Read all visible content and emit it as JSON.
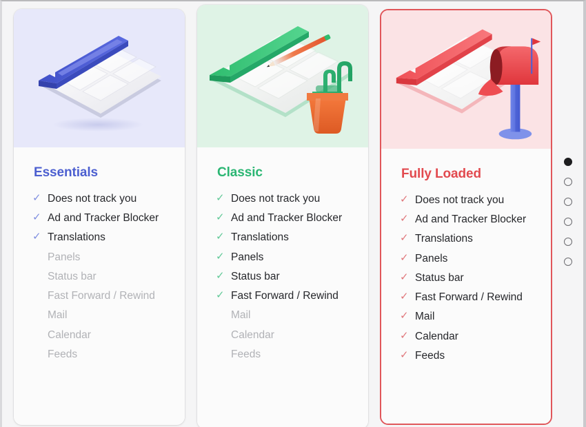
{
  "plans": [
    {
      "id": "essentials",
      "title": "Essentials",
      "accent": "#4c5fd0",
      "check_color": "#7f8ee0",
      "illustration": "keyboard-blue-icon",
      "illustration_bg": "#e7e8fa",
      "selected": false,
      "features": [
        {
          "label": "Does not track you",
          "included": true
        },
        {
          "label": "Ad and Tracker Blocker",
          "included": true
        },
        {
          "label": "Translations",
          "included": true
        },
        {
          "label": "Panels",
          "included": false
        },
        {
          "label": "Status bar",
          "included": false
        },
        {
          "label": "Fast Forward / Rewind",
          "included": false
        },
        {
          "label": "Mail",
          "included": false
        },
        {
          "label": "Calendar",
          "included": false
        },
        {
          "label": "Feeds",
          "included": false
        }
      ]
    },
    {
      "id": "classic",
      "title": "Classic",
      "accent": "#2bb673",
      "check_color": "#62c998",
      "illustration": "keyboard-green-cactus-pencil-icon",
      "illustration_bg": "#dff3e6",
      "selected": false,
      "features": [
        {
          "label": "Does not track you",
          "included": true
        },
        {
          "label": "Ad and Tracker Blocker",
          "included": true
        },
        {
          "label": "Translations",
          "included": true
        },
        {
          "label": "Panels",
          "included": true
        },
        {
          "label": "Status bar",
          "included": true
        },
        {
          "label": "Fast Forward / Rewind",
          "included": true
        },
        {
          "label": "Mail",
          "included": false
        },
        {
          "label": "Calendar",
          "included": false
        },
        {
          "label": "Feeds",
          "included": false
        }
      ]
    },
    {
      "id": "fully-loaded",
      "title": "Fully Loaded",
      "accent": "#e24a4f",
      "check_color": "#e0787c",
      "illustration": "keyboard-red-mailbox-icon",
      "illustration_bg": "#fbe3e5",
      "selected": true,
      "features": [
        {
          "label": "Does not track you",
          "included": true
        },
        {
          "label": "Ad and Tracker Blocker",
          "included": true
        },
        {
          "label": "Translations",
          "included": true
        },
        {
          "label": "Panels",
          "included": true
        },
        {
          "label": "Status bar",
          "included": true
        },
        {
          "label": "Fast Forward / Rewind",
          "included": true
        },
        {
          "label": "Mail",
          "included": true
        },
        {
          "label": "Calendar",
          "included": true
        },
        {
          "label": "Feeds",
          "included": true
        }
      ]
    }
  ],
  "check_glyph": "✓",
  "pager": {
    "total": 6,
    "active_index": 0,
    "active_color": "#1d1d1f",
    "inactive_border_color": "#6b6b70"
  },
  "colors": {
    "page_background": "#f5f5f6",
    "card_background": "#fbfbfb",
    "feature_text": "#26272b",
    "feature_text_disabled": "#b1b2b6",
    "selected_border": "#e0565a"
  }
}
